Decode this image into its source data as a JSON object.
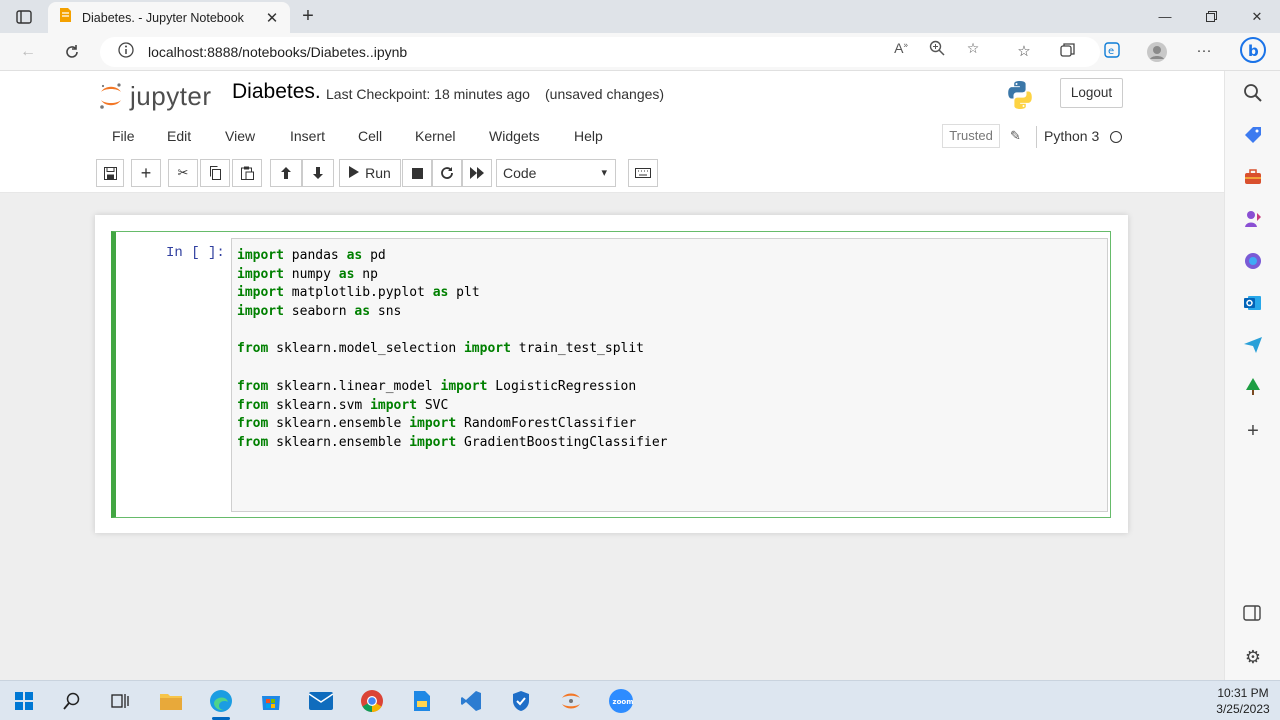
{
  "browser": {
    "tab_title": "Diabetes. - Jupyter Notebook",
    "url": "localhost:8888/notebooks/Diabetes..ipynb"
  },
  "jupyter": {
    "logo_text": "jupyter",
    "notebook_name": "Diabetes.",
    "checkpoint": "Last Checkpoint: 18 minutes ago",
    "unsaved": "(unsaved changes)",
    "logout_label": "Logout",
    "menu": [
      "File",
      "Edit",
      "View",
      "Insert",
      "Cell",
      "Kernel",
      "Widgets",
      "Help"
    ],
    "trusted_label": "Trusted",
    "kernel_name": "Python 3",
    "run_label": "Run",
    "cell_type": "Code"
  },
  "cell": {
    "prompt": "In [ ]:",
    "code_lines": [
      [
        [
          "kw",
          "import"
        ],
        [
          "t",
          " pandas "
        ],
        [
          "kw",
          "as"
        ],
        [
          "t",
          " pd"
        ]
      ],
      [
        [
          "kw",
          "import"
        ],
        [
          "t",
          " numpy "
        ],
        [
          "kw",
          "as"
        ],
        [
          "t",
          " np"
        ]
      ],
      [
        [
          "kw",
          "import"
        ],
        [
          "t",
          " matplotlib.pyplot "
        ],
        [
          "kw",
          "as"
        ],
        [
          "t",
          " plt"
        ]
      ],
      [
        [
          "kw",
          "import"
        ],
        [
          "t",
          " seaborn "
        ],
        [
          "kw",
          "as"
        ],
        [
          "t",
          " sns"
        ]
      ],
      [],
      [
        [
          "kw",
          "from"
        ],
        [
          "t",
          " sklearn.model_selection "
        ],
        [
          "kw",
          "import"
        ],
        [
          "t",
          " train_test_split"
        ]
      ],
      [],
      [
        [
          "kw",
          "from"
        ],
        [
          "t",
          " sklearn.linear_model "
        ],
        [
          "kw",
          "import"
        ],
        [
          "t",
          " LogisticRegression"
        ]
      ],
      [
        [
          "kw",
          "from"
        ],
        [
          "t",
          " sklearn.svm "
        ],
        [
          "kw",
          "import"
        ],
        [
          "t",
          " SVC"
        ]
      ],
      [
        [
          "kw",
          "from"
        ],
        [
          "t",
          " sklearn.ensemble "
        ],
        [
          "kw",
          "import"
        ],
        [
          "t",
          " RandomForestClassifier"
        ]
      ],
      [
        [
          "kw",
          "from"
        ],
        [
          "t",
          " sklearn.ensemble "
        ],
        [
          "kw",
          "import"
        ],
        [
          "t",
          " GradientBoostingClassifier"
        ]
      ]
    ]
  },
  "taskbar": {
    "time": "10:31 PM",
    "date": "3/25/2023"
  },
  "colors": {
    "keyword": "#008000",
    "prompt": "#303f9f",
    "cell_border": "#42a642",
    "taskbar_accent": "#0067c0"
  }
}
